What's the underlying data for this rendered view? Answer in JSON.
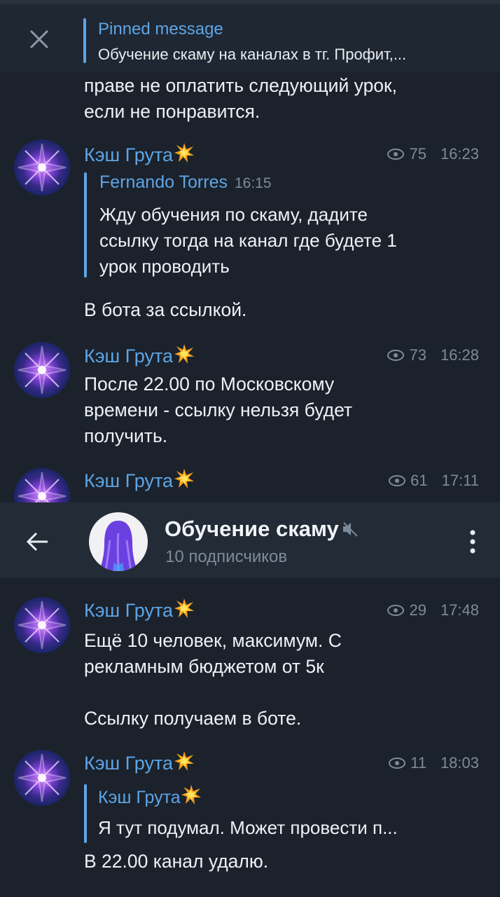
{
  "pinned": {
    "title": "Pinned message",
    "text": "Обучение скаму на каналах в тг.   Профит,..."
  },
  "top_fragment": "праве не оплатить следующий урок,\nесли не понравится.",
  "header": {
    "channel_name": "Обучение скаму",
    "subscribers": "10 подписчиков"
  },
  "messages": [
    {
      "sender": "Кэш Грута",
      "views": "75",
      "time": "16:23",
      "reply": {
        "name": "Fernando Torres",
        "time": "16:15",
        "text": "Жду обучения по скаму, дадите\nссылку тогда на канал где будете 1\nурок проводить"
      },
      "text": "В бота за ссылкой."
    },
    {
      "sender": "Кэш Грута",
      "views": "73",
      "time": "16:28",
      "text": "После 22.00 по Московскому\nвремени - ссылку нельзя будет\nполучить."
    },
    {
      "sender": "Кэш Грута",
      "views": "61",
      "time": "17:11",
      "text": ""
    },
    {
      "sender": "Кэш Грута",
      "views": "29",
      "time": "17:48",
      "text": "Ещё 10 человек, максимум. С\nрекламным бюджетом от 5к\n\nСсылку получаем в боте."
    },
    {
      "sender": "Кэш Грута",
      "views": "11",
      "time": "18:03",
      "reply": {
        "name": "Кэш Грута",
        "time": "",
        "text": "Я тут подумал. Может провести п..."
      },
      "text": "В 22.00 канал удалю."
    }
  ],
  "colors": {
    "background": "#1b222c",
    "accent": "#5ea5e6",
    "muted": "#7d8b99",
    "header": "#222b36"
  },
  "icons": {
    "close": "close-icon",
    "back": "arrow-left-icon",
    "menu": "more-vertical-icon",
    "views": "eye-icon",
    "mute": "muted-speaker-icon",
    "burst": "collision-emoji-icon"
  }
}
